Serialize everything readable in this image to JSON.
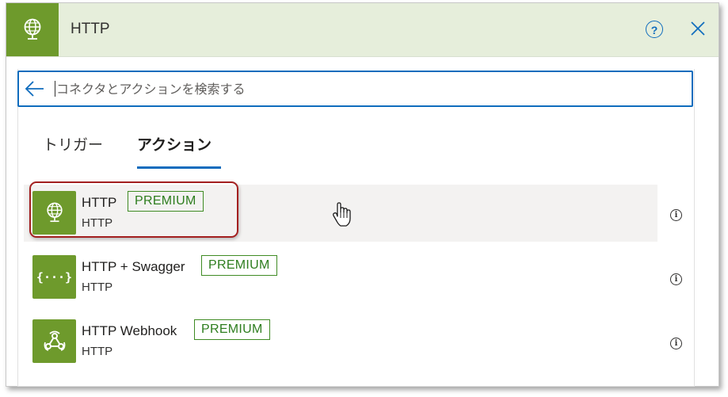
{
  "header": {
    "title": "HTTP",
    "icon": "globe-icon",
    "help_label": "?",
    "accent_color": "#6e9a2c"
  },
  "search": {
    "placeholder": "コネクタとアクションを検索する"
  },
  "tabs": [
    {
      "label": "トリガー",
      "active": false
    },
    {
      "label": "アクション",
      "active": true
    }
  ],
  "actions": [
    {
      "name": "HTTP",
      "badge": "PREMIUM",
      "connector": "HTTP",
      "icon": "globe-icon",
      "hovered": true
    },
    {
      "name": "HTTP + Swagger",
      "badge": "PREMIUM",
      "connector": "HTTP",
      "icon": "swagger-braces-icon",
      "hovered": false
    },
    {
      "name": "HTTP Webhook",
      "badge": "PREMIUM",
      "connector": "HTTP",
      "icon": "webhook-icon",
      "hovered": false
    }
  ],
  "info_glyph": "i",
  "swagger_glyph": "{···}"
}
